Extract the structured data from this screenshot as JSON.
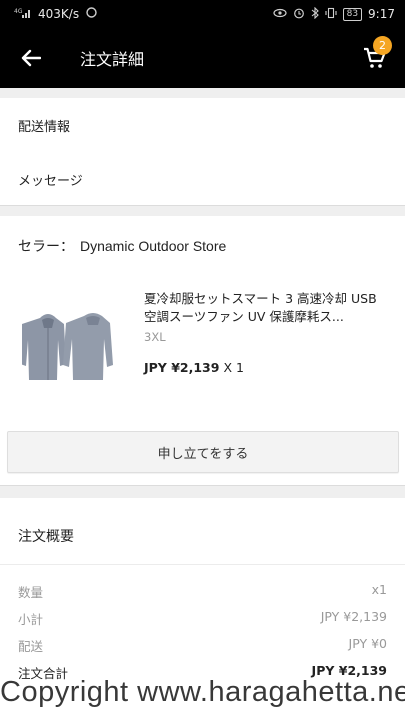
{
  "status_bar": {
    "network": "4G",
    "speed": "403K/s",
    "battery": "83",
    "time": "9:17"
  },
  "app_bar": {
    "title": "注文詳細",
    "cart_count": "2"
  },
  "info_links": [
    {
      "label": "配送情報"
    },
    {
      "label": "メッセージ"
    }
  ],
  "order": {
    "seller_label": "セラー：",
    "store_name": "Dynamic Outdoor Store",
    "product": {
      "title": "夏冷却服セットスマート 3 高速冷却 USB 空調スーツファン UV 保護摩耗ス...",
      "variant": "3XL",
      "price": "JPY ¥2,139",
      "quantity": "X 1"
    },
    "claim_button": "申し立てをする"
  },
  "summary": {
    "title": "注文概要",
    "rows": [
      {
        "label": "数量",
        "value": "x1"
      },
      {
        "label": "小計",
        "value": "JPY ¥2,139"
      },
      {
        "label": "配送",
        "value": "JPY ¥0"
      },
      {
        "label": "注文合計",
        "value": "JPY ¥2,139"
      }
    ]
  },
  "watermark": "Copyright www.haragahetta.net",
  "colors": {
    "accent_badge": "#f5a623",
    "app_bar": "#000000",
    "background": "#efefef"
  }
}
